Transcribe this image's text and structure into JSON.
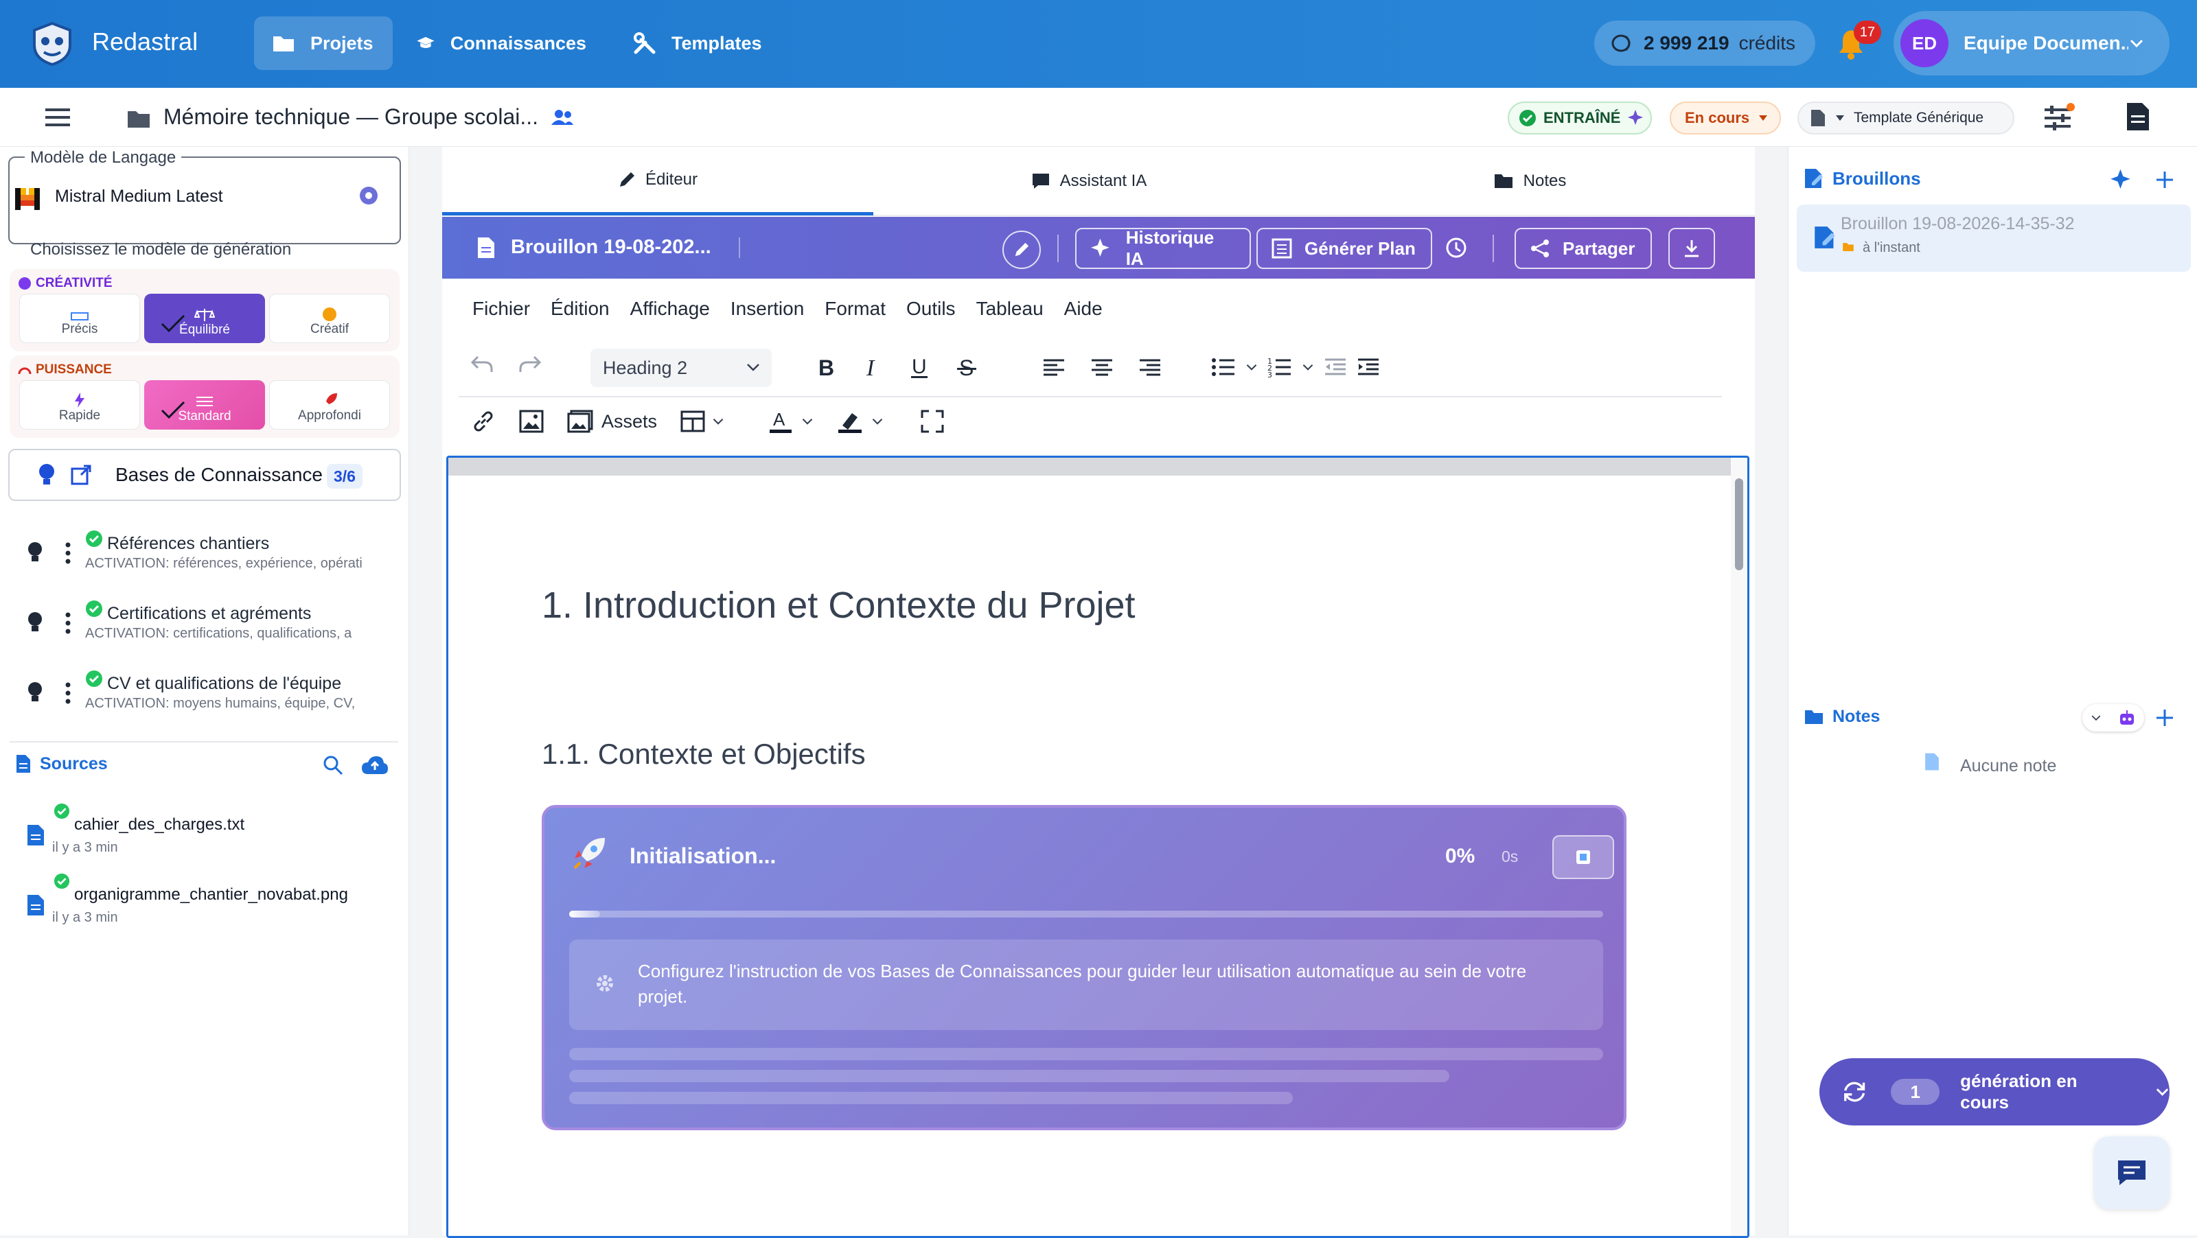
{
  "colors": {
    "primary": "#1f78cf",
    "accent_purple": "#6d4fd1",
    "success": "#16a34a",
    "warning": "#f97316",
    "danger": "#dc2626"
  },
  "topbar": {
    "brand": "Redastral",
    "tabs": [
      {
        "label": "Projets",
        "icon": "folder-icon",
        "active": true
      },
      {
        "label": "Connaissances",
        "icon": "graduation-cap-icon"
      },
      {
        "label": "Templates",
        "icon": "tools-icon"
      }
    ],
    "credits_value": "2 999 219",
    "credits_label": "crédits",
    "notifications": "17",
    "user_initials": "ED",
    "user_name": "Equipe Documen..."
  },
  "subbar": {
    "project_title": "Mémoire technique — Groupe scolai...",
    "trained_label": "ENTRAÎNÉ",
    "status_label": "En cours",
    "template_label": "Template Générique"
  },
  "left": {
    "model_legend": "Modèle de Langage",
    "model_name": "Mistral Medium Latest",
    "model_help": "Choisissez le modèle de génération",
    "creativity_title": "CRÉATIVITÉ",
    "creativity_options": [
      "Précis",
      "Équilibré",
      "Créatif"
    ],
    "power_title": "PUISSANCE",
    "power_options": [
      "Rapide",
      "Standard",
      "Approfondi"
    ],
    "kb_title": "Bases de Connaissance",
    "kb_count": "3/6",
    "kb_items": [
      {
        "title": "Références chantiers",
        "sub": "ACTIVATION: références, expérience, opérati"
      },
      {
        "title": "Certifications et agréments",
        "sub": "ACTIVATION: certifications, qualifications, a"
      },
      {
        "title": "CV et qualifications de l'équipe",
        "sub": "ACTIVATION: moyens humains, équipe, CV,"
      }
    ],
    "sources_title": "Sources",
    "sources": [
      {
        "name": "cahier_des_charges.txt",
        "time": "il y a 3 min"
      },
      {
        "name": "organigramme_chantier_novabat.png",
        "time": "il y a 3 min"
      }
    ]
  },
  "center": {
    "tabs": [
      "Éditeur",
      "Assistant IA",
      "Notes"
    ],
    "doc_title": "Brouillon 19-08-202...",
    "btn_history": "Historique IA",
    "btn_plan": "Générer Plan",
    "btn_share": "Partager",
    "menu": [
      "Fichier",
      "Édition",
      "Affichage",
      "Insertion",
      "Format",
      "Outils",
      "Tableau",
      "Aide"
    ],
    "block_format": "Heading 2",
    "assets_label": "Assets",
    "heading1": "1. Introduction et Contexte du Projet",
    "heading2": "1.1. Contexte et Objectifs",
    "gen_status": "Initialisation...",
    "gen_percent": "0%",
    "gen_time": "0s",
    "gen_progress": 0.03,
    "gen_message": "Configurez l'instruction de vos Bases de Connaissances pour guider leur utilisation automatique au sein de votre projet."
  },
  "right": {
    "drafts_title": "Brouillons",
    "draft_name": "Brouillon 19-08-2026-14-35-32",
    "draft_time": "à l'instant",
    "notes_title": "Notes",
    "notes_empty": "Aucune note",
    "gen_count": "1",
    "gen_label": "génération en cours"
  }
}
